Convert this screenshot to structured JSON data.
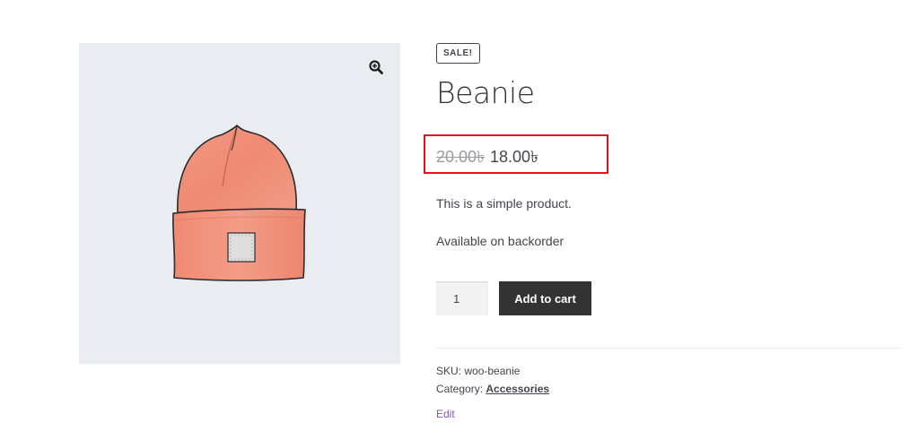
{
  "product": {
    "badge": "SALE!",
    "title": "Beanie",
    "price": {
      "regular": "20.00৳",
      "sale": "18.00৳"
    },
    "short_description": "This is a simple product.",
    "stock_status": "Available on backorder"
  },
  "cart": {
    "quantity": "1",
    "add_label": "Add to cart"
  },
  "meta": {
    "sku_label": "SKU:",
    "sku_value": "woo-beanie",
    "category_label": "Category:",
    "category_value": "Accessories"
  },
  "edit_label": "Edit",
  "icons": {
    "zoom": "zoom-in-icon",
    "image": "beanie-image"
  },
  "colors": {
    "highlight_box": "#e8101d",
    "button_bg": "#333333",
    "image_bg": "#e9edf2",
    "edit_link": "#7f54b3"
  }
}
